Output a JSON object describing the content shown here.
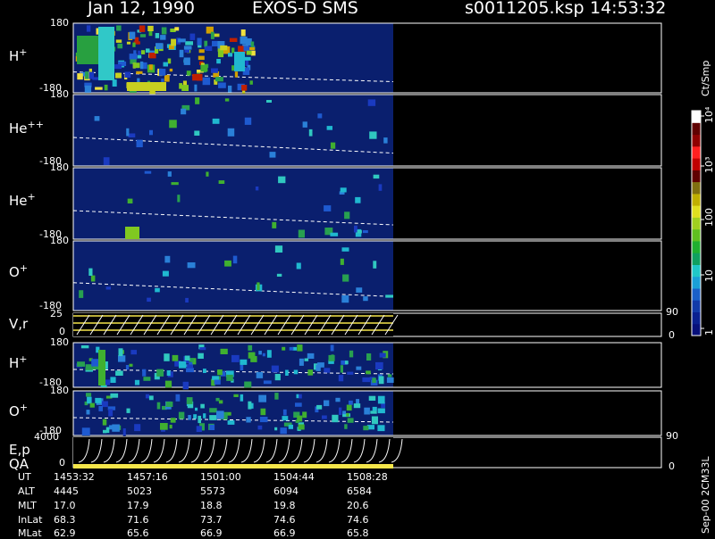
{
  "header": {
    "date": "Jan 12, 1990",
    "instrument": "EXOS-D SMS",
    "file": "s0011205.ksp",
    "time": "14:53:32"
  },
  "side_labels": {
    "units": "Ct/Smp",
    "footer": "Sep-00 2CM33L"
  },
  "colors": {
    "background": "#000000",
    "panel_fill": "#0a1f6e",
    "axis": "#ffffff",
    "trace": "#ffffff",
    "yellow": "#f5e64a"
  },
  "chart_data": {
    "type": "heatmap",
    "panels": [
      {
        "label": "H",
        "sup": "+",
        "ymax": "180",
        "ymin": "-180",
        "dashed_line": [
          0.7,
          0.84
        ]
      },
      {
        "label": "He",
        "sup": "++",
        "ymax": "180",
        "ymin": "-180",
        "dashed_line": [
          0.6,
          0.82
        ]
      },
      {
        "label": "He",
        "sup": "+",
        "ymax": "180",
        "ymin": "-180",
        "dashed_line": [
          0.6,
          0.8
        ]
      },
      {
        "label": "O",
        "sup": "+",
        "ymax": "180",
        "ymin": "-180",
        "dashed_line": [
          0.6,
          0.8
        ]
      },
      {
        "label": "V,r",
        "sup": "",
        "ymax": "25",
        "ymin": "0",
        "right_ticks": [
          "90",
          "0"
        ]
      },
      {
        "label": "H",
        "sup": "+",
        "ymax": "180",
        "ymin": "-180",
        "dashed_line": [
          0.6,
          0.7
        ]
      },
      {
        "label": "O",
        "sup": "+",
        "ymax": "180",
        "ymin": "-180",
        "dashed_line": [
          0.6,
          0.7
        ]
      },
      {
        "label": "E,p",
        "sub_label": "QA",
        "sup": "",
        "ymax": "4000",
        "ymin": "0",
        "right_ticks": [
          "90",
          "0"
        ]
      }
    ],
    "colorbar": {
      "label": "Ct/Smp",
      "ticks": [
        "1",
        "10",
        "100",
        "10³",
        "10⁴"
      ],
      "colors": [
        "#07107a",
        "#0a2090",
        "#123aa8",
        "#1a60c8",
        "#1aa0d8",
        "#20c8c8",
        "#10a060",
        "#20b030",
        "#60c020",
        "#a0d020",
        "#e0e020",
        "#c0b000",
        "#807010",
        "#600000",
        "#c00000",
        "#ff2020",
        "#900000",
        "#600000",
        "#ffffff"
      ]
    },
    "x_axis": {
      "rows": [
        {
          "name": "UT",
          "values": [
            "1453:32",
            "1457:16",
            "1501:00",
            "1504:44",
            "1508:28"
          ]
        },
        {
          "name": "ALT",
          "values": [
            "4445",
            "5023",
            "5573",
            "6094",
            "6584"
          ]
        },
        {
          "name": "MLT",
          "values": [
            "17.0",
            "17.9",
            "18.8",
            "19.8",
            "20.6"
          ]
        },
        {
          "name": "InLat",
          "values": [
            "68.3",
            "71.6",
            "73.7",
            "74.6",
            "74.6"
          ]
        },
        {
          "name": "MLat",
          "values": [
            "62.9",
            "65.6",
            "66.9",
            "66.9",
            "65.8"
          ]
        }
      ]
    }
  }
}
